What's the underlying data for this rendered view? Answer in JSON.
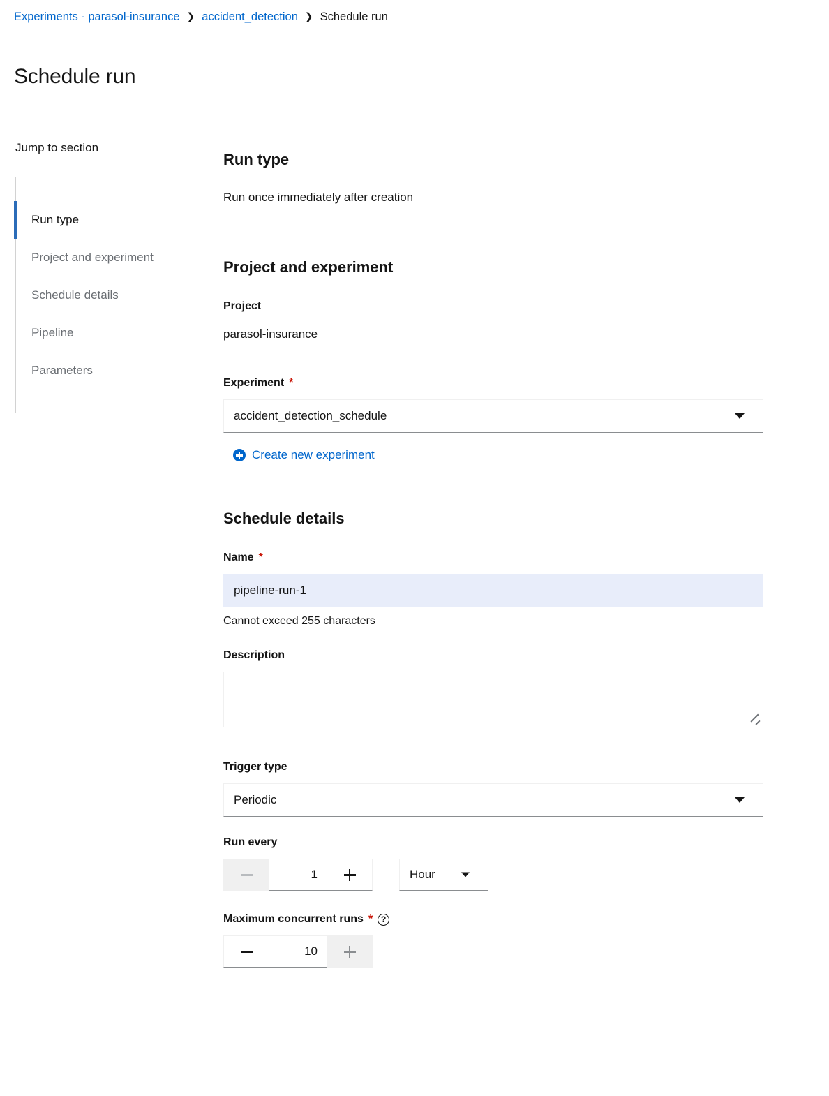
{
  "breadcrumb": {
    "items": [
      {
        "label": "Experiments - parasol-insurance",
        "type": "link"
      },
      {
        "label": "accident_detection",
        "type": "link"
      },
      {
        "label": "Schedule run",
        "type": "current"
      }
    ],
    "separator": "❯"
  },
  "page_title": "Schedule run",
  "jump_to_section": {
    "title": "Jump to section",
    "items": [
      {
        "label": "Run type",
        "active": true
      },
      {
        "label": "Project and experiment",
        "active": false
      },
      {
        "label": "Schedule details",
        "active": false
      },
      {
        "label": "Pipeline",
        "active": false
      },
      {
        "label": "Parameters",
        "active": false
      }
    ]
  },
  "run_type": {
    "heading": "Run type",
    "value": "Run once immediately after creation"
  },
  "project_and_experiment": {
    "heading": "Project and experiment",
    "project_label": "Project",
    "project_value": "parasol-insurance",
    "experiment_label": "Experiment",
    "experiment_required": "*",
    "experiment_value": "accident_detection_schedule",
    "create_new_experiment": "Create new experiment"
  },
  "schedule_details": {
    "heading": "Schedule details",
    "name_label": "Name",
    "name_required": "*",
    "name_value": "pipeline-run-1",
    "name_hint": "Cannot exceed 255 characters",
    "description_label": "Description",
    "description_value": "",
    "trigger_type_label": "Trigger type",
    "trigger_type_value": "Periodic",
    "run_every_label": "Run every",
    "run_every_value": "1",
    "run_every_unit": "Hour",
    "max_concurrent_label": "Maximum concurrent runs",
    "max_concurrent_required": "*",
    "max_concurrent_help": "?",
    "max_concurrent_value": "10"
  },
  "colors": {
    "link_blue": "#0066cc",
    "active_indicator": "#2b6cb8",
    "required_red": "#c9190b",
    "input_filled_bg": "#e8edfa",
    "disabled_bg": "#f0f0f0"
  }
}
